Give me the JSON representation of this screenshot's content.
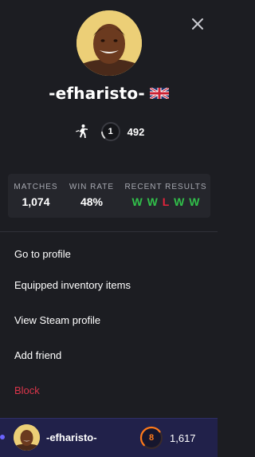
{
  "profile": {
    "username": "-efharisto-",
    "country_flag": "uk-flag-icon",
    "level": "1",
    "level_progress": 0.15,
    "elo": "492"
  },
  "stats": {
    "matches_label": "MATCHES",
    "matches_value": "1,074",
    "winrate_label": "WIN RATE",
    "winrate_value": "48%",
    "results_label": "RECENT RESULTS",
    "results": [
      "W",
      "W",
      "L",
      "W",
      "W"
    ]
  },
  "menu": {
    "items": [
      {
        "label": "Go to profile"
      },
      {
        "label": "Equipped inventory items"
      },
      {
        "label": "View Steam profile"
      },
      {
        "label": "Add friend"
      },
      {
        "label": "Block"
      }
    ]
  },
  "footer": {
    "username": "-efharisto-",
    "level": "8",
    "level_progress": 0.7,
    "elo": "1,617"
  },
  "colors": {
    "background": "#1c1d22",
    "stats_background": "#25262c",
    "win": "#31c04a",
    "loss": "#e5233b",
    "block": "#d9354a",
    "footer_background": "#21214a",
    "level8_accent": "#ff7a1a"
  },
  "icons": {
    "close": "close-icon",
    "player": "player-icon"
  }
}
